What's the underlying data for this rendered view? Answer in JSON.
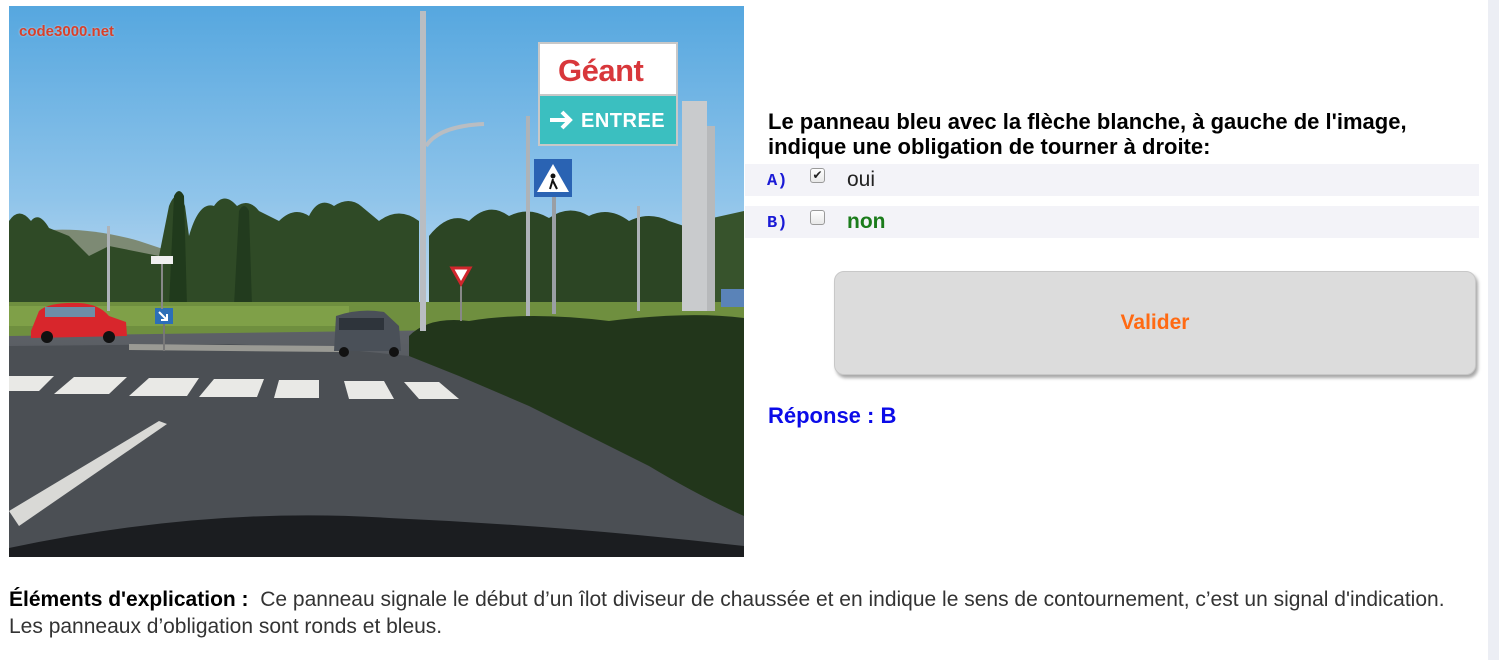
{
  "scene": {
    "watermark": "code3000.net",
    "store_sign": "Géant",
    "entrance_sign": "ENTREE",
    "entrance_arrow": "arrow-right-icon"
  },
  "question": {
    "text": "Le panneau bleu avec la flèche blanche, à gauche de l'image, indique une obligation de tourner à droite:",
    "answers": [
      {
        "letter": "A)",
        "text": "oui",
        "checked": true,
        "check_mark": "✔"
      },
      {
        "letter": "B)",
        "text": "non",
        "checked": false,
        "check_mark": ""
      }
    ]
  },
  "validate_label": "Valider",
  "response": "Réponse : B",
  "explanation": {
    "label": "Éléments d'explication :",
    "text": "Ce panneau signale le début d’un îlot diviseur de chaussée et en indique le sens de contournement, c’est un signal d'indication. Les panneaux d’obligation sont ronds et bleus."
  },
  "colors": {
    "letter": "#1a1ad6",
    "answer_b": "#1b7c1b",
    "validate_text": "#ff6a13",
    "response": "#0b0be8",
    "row_bg": "#f3f3f8",
    "sign_blue": "#2c7fc1",
    "sign_teal": "#3bbfc0"
  }
}
